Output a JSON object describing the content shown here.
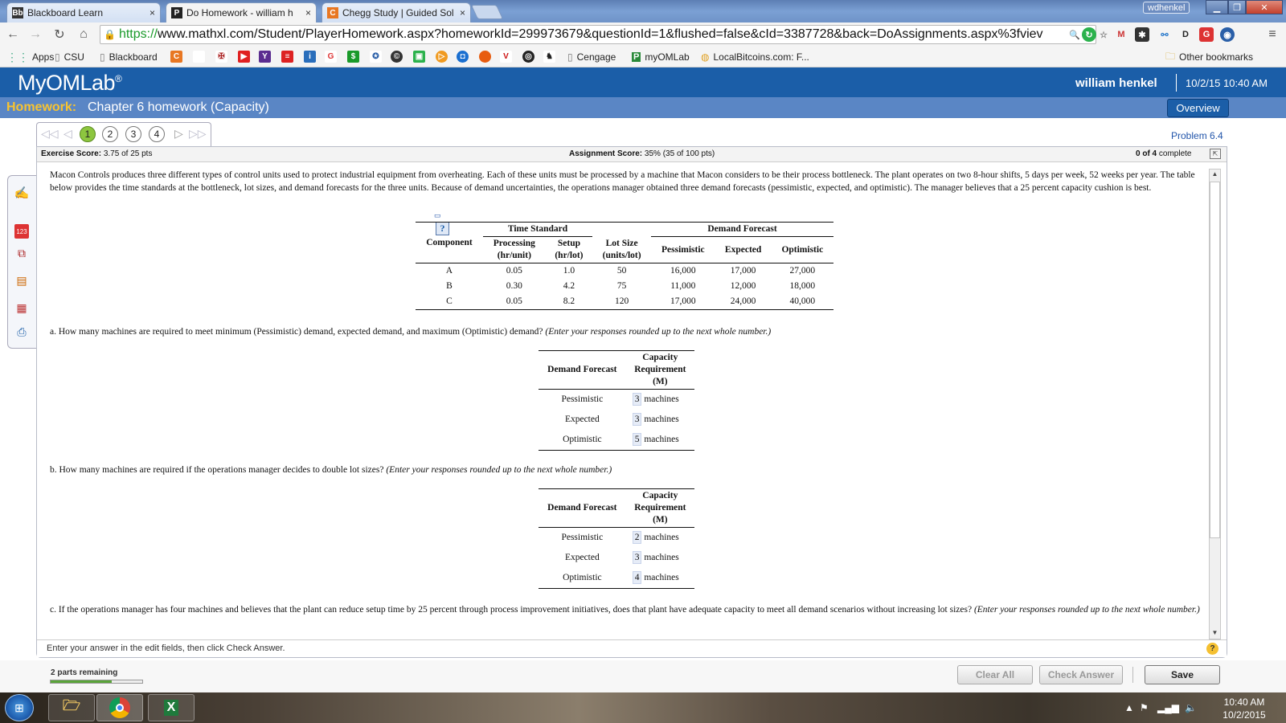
{
  "browser": {
    "tabs": [
      {
        "icon": "Bb",
        "title": "Blackboard Learn"
      },
      {
        "icon": "P",
        "title": "Do Homework - william h"
      },
      {
        "icon": "C",
        "title": "Chegg Study | Guided Sol"
      }
    ],
    "close_glyph": "×",
    "user_button": "wdhenkel",
    "url_scheme": "https://",
    "url_rest": "www.mathxl.com/Student/PlayerHomework.aspx?homeworkId=299973679&questionId=1&flushed=false&cId=3387728&back=DoAssignments.aspx%3fviev",
    "bookmarks": {
      "apps": "Apps",
      "csu": "CSU",
      "blackboard": "Blackboard",
      "cengage": "Cengage",
      "myomlab": "myOMLab",
      "localbitcoins": "LocalBitcoins.com: F...",
      "other": "Other bookmarks"
    }
  },
  "app": {
    "logo": "MyOMLab",
    "logo_reg": "®",
    "user_name": "william henkel",
    "datetime": "10/2/15 10:40 AM",
    "homework_label": "Homework:",
    "homework_title": "Chapter 6 homework (Capacity)",
    "overview_button": "Overview",
    "problem_label": "Problem 6.4",
    "questions": [
      "1",
      "2",
      "3",
      "4"
    ],
    "current_question": "1"
  },
  "scores": {
    "exercise_label": "Exercise Score:",
    "exercise_value": "3.75 of 25 pts",
    "assignment_label": "Assignment Score:",
    "assignment_value": "35% (35 of 100 pts)",
    "complete_count": "0 of 4",
    "complete_label": "complete"
  },
  "problem": {
    "intro": "Macon Controls produces three different types of control units used to protect industrial equipment from overheating. Each of these units must be processed by a machine that Macon considers to be their process bottleneck. The plant operates on two 8-hour shifts, 5 days per week, 52 weeks per year. The table below provides the time standards at the bottleneck, lot sizes, and demand forecasts for the three units. Because of demand uncertainties, the operations manager obtained three demand forecasts (pessimistic, expected, and optimistic). The manager believes that a 25 percent capacity cushion is best.",
    "table": {
      "group_time": "Time Standard",
      "group_demand": "Demand Forecast",
      "col_component": "Component",
      "col_processing": "Processing",
      "col_processing_unit": "(hr/unit)",
      "col_setup": "Setup",
      "col_setup_unit": "(hr/lot)",
      "col_lot": "Lot Size",
      "col_lot_unit": "(units/lot)",
      "col_pess": "Pessimistic",
      "col_exp": "Expected",
      "col_opt": "Optimistic",
      "rows": [
        {
          "component": "A",
          "processing": "0.05",
          "setup": "1.0",
          "lot": "50",
          "pess": "16,000",
          "exp": "17,000",
          "opt": "27,000"
        },
        {
          "component": "B",
          "processing": "0.30",
          "setup": "4.2",
          "lot": "75",
          "pess": "11,000",
          "exp": "12,000",
          "opt": "18,000"
        },
        {
          "component": "C",
          "processing": "0.05",
          "setup": "8.2",
          "lot": "120",
          "pess": "17,000",
          "exp": "24,000",
          "opt": "40,000"
        }
      ]
    },
    "part_a": {
      "text": "a. How many machines are required to meet minimum (Pessimistic) demand, expected demand, and maximum (Optimistic) demand?",
      "hint": "(Enter your responses rounded up to the next whole number.)",
      "col1": "Demand Forecast",
      "col2_l1": "Capacity",
      "col2_l2": "Requirement",
      "col2_l3": "(M)",
      "unit": "machines",
      "rows": [
        {
          "label": "Pessimistic",
          "value": "3"
        },
        {
          "label": "Expected",
          "value": "3"
        },
        {
          "label": "Optimistic",
          "value": "5"
        }
      ]
    },
    "part_b": {
      "text": "b. How many machines are required if the operations manager decides to double lot sizes?",
      "hint": "(Enter your responses rounded up to the next whole number.)",
      "col1": "Demand Forecast",
      "col2_l1": "Capacity",
      "col2_l2": "Requirement",
      "col2_l3": "(M)",
      "unit": "machines",
      "rows": [
        {
          "label": "Pessimistic",
          "value": "2"
        },
        {
          "label": "Expected",
          "value": "3"
        },
        {
          "label": "Optimistic",
          "value": "4"
        }
      ]
    },
    "part_c": {
      "text": "c. If the operations manager has four machines and believes that the plant can reduce setup time by 25 percent through process improvement initiatives, does that plant have adequate capacity to meet all demand scenarios without increasing lot sizes?",
      "hint": "(Enter your responses rounded up to the next whole number.)"
    }
  },
  "footer": {
    "instruction": "Enter your answer in the edit fields, then click Check Answer.",
    "help_glyph": "?",
    "parts_remaining": "2 parts remaining",
    "progress_fraction": 0.67,
    "clear_all": "Clear All",
    "check_answer": "Check Answer",
    "save": "Save"
  },
  "taskbar": {
    "time": "10:40 AM",
    "date": "10/2/2015"
  },
  "colors": {
    "header_blue": "#1b5ea8",
    "homework_bar": "#5a86c5",
    "homework_label": "#f7c331",
    "current_question": "#8dc63f"
  }
}
